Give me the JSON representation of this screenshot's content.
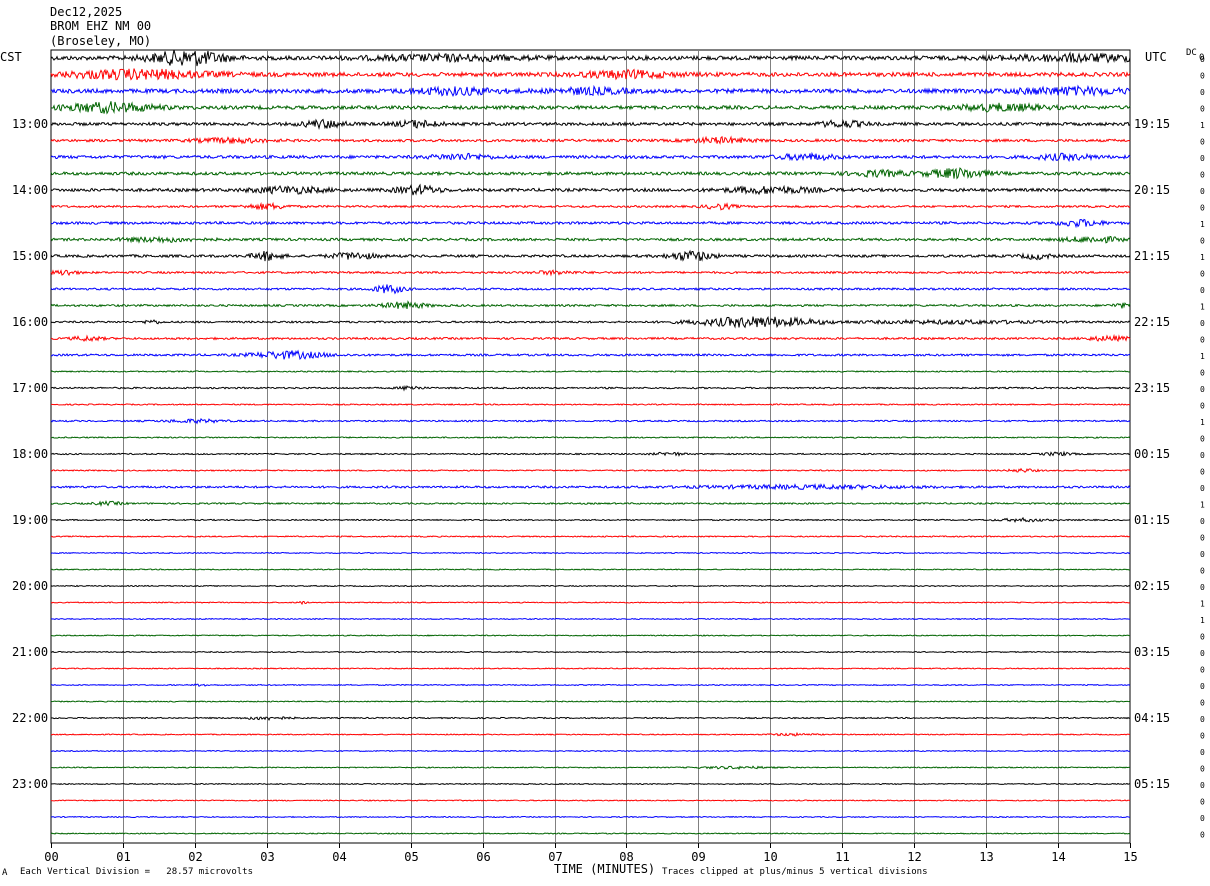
{
  "header": {
    "date": "Dec12,2025",
    "station": "BROM EHZ NM 00",
    "location": "(Broseley, MO)"
  },
  "left_label": "CST",
  "right_label": "UTC",
  "dc_label": "DC",
  "dc_first": "0",
  "footer": {
    "left_mark": "A",
    "scale_text": "Each Vertical Division =   28.57 microvolts",
    "xlabel": "TIME (MINUTES)",
    "clip_text": "Traces clipped at plus/minus 5 vertical divisions"
  },
  "chart_data": {
    "type": "line",
    "x_ticks": [
      "00",
      "01",
      "02",
      "03",
      "04",
      "05",
      "06",
      "07",
      "08",
      "09",
      "10",
      "11",
      "12",
      "13",
      "14",
      "15"
    ],
    "xlim": [
      0,
      15
    ],
    "xlabel": "TIME (MINUTES)",
    "cst_hour_labels": [
      "13:00",
      "14:00",
      "15:00",
      "16:00",
      "17:00",
      "18:00",
      "19:00",
      "20:00",
      "21:00",
      "22:00",
      "23:00"
    ],
    "utc_hour_labels": [
      "19:15",
      "20:15",
      "21:15",
      "22:15",
      "23:15",
      "00:15",
      "01:15",
      "02:15",
      "03:15",
      "04:15",
      "05:15"
    ],
    "trace_colors": [
      "#000000",
      "#ff0000",
      "#0000ff",
      "#006400"
    ],
    "dc_values": [
      "0",
      "0",
      "0",
      "0",
      "1",
      "0",
      "0",
      "0",
      "0",
      "0",
      "1",
      "0",
      "1",
      "0",
      "0",
      "1",
      "0",
      "0",
      "1",
      "0",
      "0",
      "0",
      "1",
      "0",
      "0",
      "0",
      "0",
      "1",
      "0",
      "0",
      "0",
      "0",
      "0",
      "1",
      "1",
      "0",
      "0",
      "0",
      "0",
      "0",
      "0",
      "0",
      "0",
      "0",
      "0",
      "0",
      "0",
      "0"
    ],
    "traces": [
      {
        "amp": 4,
        "events": [
          {
            "t": 1.9,
            "a": 14,
            "w": 0.5
          },
          {
            "t": 5.5,
            "a": 5,
            "w": 1.0
          },
          {
            "t": 14.3,
            "a": 6,
            "w": 1.0
          }
        ]
      },
      {
        "amp": 4,
        "events": [
          {
            "t": 1.2,
            "a": 8,
            "w": 1.0
          },
          {
            "t": 8.0,
            "a": 6,
            "w": 0.6
          }
        ]
      },
      {
        "amp": 4,
        "events": [
          {
            "t": 5.6,
            "a": 6,
            "w": 0.6
          },
          {
            "t": 7.5,
            "a": 5,
            "w": 0.5
          },
          {
            "t": 14.2,
            "a": 6,
            "w": 0.8
          }
        ]
      },
      {
        "amp": 3.5,
        "events": [
          {
            "t": 0.8,
            "a": 9,
            "w": 0.6
          },
          {
            "t": 13.2,
            "a": 6,
            "w": 0.6
          }
        ]
      },
      {
        "amp": 3,
        "events": [
          {
            "t": 3.8,
            "a": 7,
            "w": 0.3
          },
          {
            "t": 5.1,
            "a": 6,
            "w": 0.3
          },
          {
            "t": 11.0,
            "a": 6,
            "w": 0.3
          }
        ]
      },
      {
        "amp": 2.5,
        "events": [
          {
            "t": 2.5,
            "a": 4,
            "w": 0.5
          },
          {
            "t": 9.3,
            "a": 5,
            "w": 0.4
          }
        ]
      },
      {
        "amp": 3,
        "events": [
          {
            "t": 5.7,
            "a": 5,
            "w": 0.4
          },
          {
            "t": 10.5,
            "a": 5,
            "w": 0.4
          },
          {
            "t": 14.1,
            "a": 5,
            "w": 0.4
          }
        ]
      },
      {
        "amp": 3,
        "events": [
          {
            "t": 12.6,
            "a": 9,
            "w": 0.4
          },
          {
            "t": 11.5,
            "a": 5,
            "w": 0.4
          }
        ]
      },
      {
        "amp": 3,
        "events": [
          {
            "t": 3.3,
            "a": 6,
            "w": 0.5
          },
          {
            "t": 5.1,
            "a": 8,
            "w": 0.3
          },
          {
            "t": 10.0,
            "a": 6,
            "w": 0.6
          }
        ]
      },
      {
        "amp": 2,
        "events": [
          {
            "t": 3.0,
            "a": 5,
            "w": 0.3
          },
          {
            "t": 9.3,
            "a": 5,
            "w": 0.2
          }
        ]
      },
      {
        "amp": 2.5,
        "events": [
          {
            "t": 14.3,
            "a": 6,
            "w": 0.3
          }
        ]
      },
      {
        "amp": 2.5,
        "events": [
          {
            "t": 1.5,
            "a": 4,
            "w": 0.5
          },
          {
            "t": 14.5,
            "a": 5,
            "w": 0.4
          }
        ]
      },
      {
        "amp": 2.5,
        "events": [
          {
            "t": 3.0,
            "a": 8,
            "w": 0.2
          },
          {
            "t": 4.2,
            "a": 6,
            "w": 0.3
          },
          {
            "t": 8.9,
            "a": 9,
            "w": 0.3
          },
          {
            "t": 13.7,
            "a": 5,
            "w": 0.2
          }
        ]
      },
      {
        "amp": 2,
        "events": [
          {
            "t": 0.2,
            "a": 5,
            "w": 0.15
          },
          {
            "t": 7.0,
            "a": 3,
            "w": 0.3
          }
        ]
      },
      {
        "amp": 2,
        "events": [
          {
            "t": 4.7,
            "a": 8,
            "w": 0.2
          }
        ]
      },
      {
        "amp": 2,
        "events": [
          {
            "t": 4.9,
            "a": 6,
            "w": 0.3
          },
          {
            "t": 14.9,
            "a": 4,
            "w": 0.15
          }
        ]
      },
      {
        "amp": 1.8,
        "events": [
          {
            "t": 9.8,
            "a": 10,
            "w": 0.8
          },
          {
            "t": 12.5,
            "a": 3,
            "w": 1.2
          },
          {
            "t": 1.4,
            "a": 4,
            "w": 0.1
          }
        ]
      },
      {
        "amp": 2,
        "events": [
          {
            "t": 0.5,
            "a": 4,
            "w": 0.2
          },
          {
            "t": 14.7,
            "a": 4,
            "w": 0.3
          }
        ]
      },
      {
        "amp": 2,
        "events": [
          {
            "t": 3.3,
            "a": 7,
            "w": 0.5
          }
        ]
      },
      {
        "amp": 1.2,
        "events": []
      },
      {
        "amp": 1.5,
        "events": [
          {
            "t": 5.0,
            "a": 4,
            "w": 0.15
          }
        ]
      },
      {
        "amp": 1.2,
        "events": []
      },
      {
        "amp": 1.5,
        "events": [
          {
            "t": 2.0,
            "a": 3,
            "w": 0.4
          }
        ]
      },
      {
        "amp": 1.2,
        "events": []
      },
      {
        "amp": 1.3,
        "events": [
          {
            "t": 8.6,
            "a": 3,
            "w": 0.2
          },
          {
            "t": 14.0,
            "a": 3,
            "w": 0.2
          }
        ]
      },
      {
        "amp": 1.2,
        "events": [
          {
            "t": 13.5,
            "a": 3,
            "w": 0.2
          }
        ]
      },
      {
        "amp": 2,
        "events": [
          {
            "t": 10.5,
            "a": 3,
            "w": 1.5
          }
        ]
      },
      {
        "amp": 1.5,
        "events": [
          {
            "t": 0.8,
            "a": 3,
            "w": 0.2
          }
        ]
      },
      {
        "amp": 1.2,
        "events": [
          {
            "t": 13.5,
            "a": 3,
            "w": 0.3
          }
        ]
      },
      {
        "amp": 1.2,
        "events": []
      },
      {
        "amp": 1.0,
        "events": []
      },
      {
        "amp": 1.0,
        "events": []
      },
      {
        "amp": 1.0,
        "events": []
      },
      {
        "amp": 1.0,
        "events": [
          {
            "t": 3.5,
            "a": 3,
            "w": 0.05
          }
        ]
      },
      {
        "amp": 1.0,
        "events": []
      },
      {
        "amp": 1.0,
        "events": []
      },
      {
        "amp": 1.0,
        "events": []
      },
      {
        "amp": 1.0,
        "events": []
      },
      {
        "amp": 1.0,
        "events": [
          {
            "t": 2.1,
            "a": 2,
            "w": 0.1
          }
        ]
      },
      {
        "amp": 1.0,
        "events": []
      },
      {
        "amp": 1.2,
        "events": [
          {
            "t": 3.0,
            "a": 3,
            "w": 0.3
          }
        ]
      },
      {
        "amp": 1.0,
        "events": [
          {
            "t": 10.3,
            "a": 2,
            "w": 0.3
          }
        ]
      },
      {
        "amp": 1.0,
        "events": []
      },
      {
        "amp": 1.0,
        "events": [
          {
            "t": 9.5,
            "a": 2,
            "w": 0.5
          }
        ]
      },
      {
        "amp": 1.0,
        "events": []
      },
      {
        "amp": 1.0,
        "events": []
      },
      {
        "amp": 1.0,
        "events": []
      },
      {
        "amp": 1.0,
        "events": []
      }
    ]
  }
}
